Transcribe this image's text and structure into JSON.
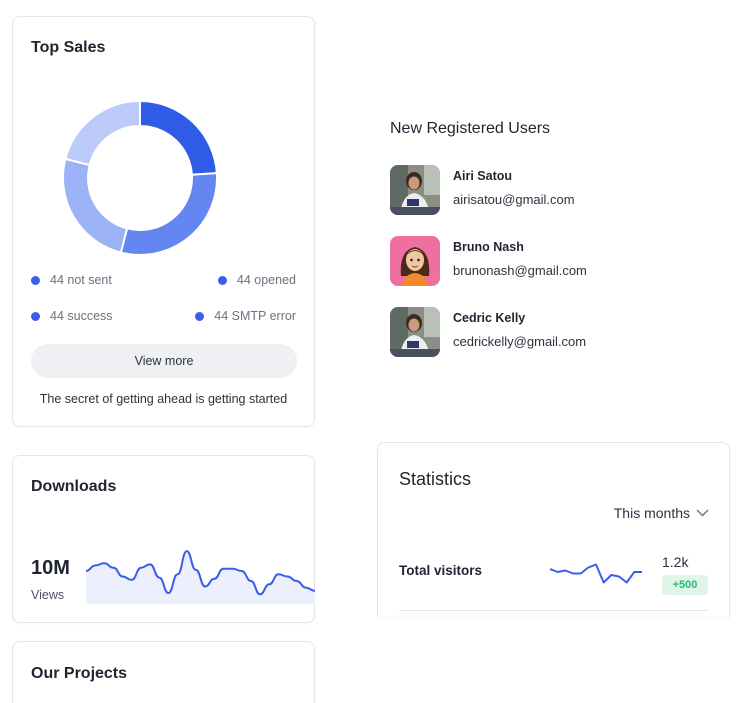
{
  "top_sales": {
    "title": "Top Sales",
    "colors": [
      "#2f5be7",
      "#6486f0",
      "#9bb2f6",
      "#bccbfa"
    ],
    "segments": [
      0.24,
      0.3,
      0.25,
      0.21
    ],
    "legend": [
      {
        "label": "44 not sent",
        "icon": "dot-icon"
      },
      {
        "label": "44 opened",
        "icon": "dot-icon"
      },
      {
        "label": "44 success",
        "icon": "dot-icon"
      },
      {
        "label": "44 SMTP error",
        "icon": "dot-icon"
      }
    ],
    "view_more_label": "View more",
    "quote": "The secret of getting ahead is getting started"
  },
  "new_users": {
    "title": "New Registered Users",
    "users": [
      {
        "name": "Airi Satou",
        "email": "airisatou@gmail.com"
      },
      {
        "name": "Bruno Nash",
        "email": "brunonash@gmail.com"
      },
      {
        "name": "Cedric Kelly",
        "email": "cedrickelly@gmail.com"
      }
    ]
  },
  "downloads": {
    "title": "Downloads",
    "value": "10M",
    "label": "Views",
    "trend": [
      28,
      33,
      35,
      31,
      23,
      20,
      31,
      34,
      22,
      8,
      25,
      46,
      29,
      14,
      21,
      30,
      30,
      28,
      19,
      7,
      16,
      25,
      23,
      19,
      13,
      10
    ]
  },
  "statistics": {
    "title": "Statistics",
    "period": "This months",
    "period_icon": "chevron-down-icon",
    "total_visitors_label": "Total visitors",
    "total_visitors_value": "1.2k",
    "total_visitors_change": "+500",
    "trend": [
      14,
      12,
      13,
      11,
      11,
      15,
      17,
      5,
      10,
      9,
      5,
      12,
      12
    ]
  },
  "projects": {
    "title": "Our Projects"
  }
}
